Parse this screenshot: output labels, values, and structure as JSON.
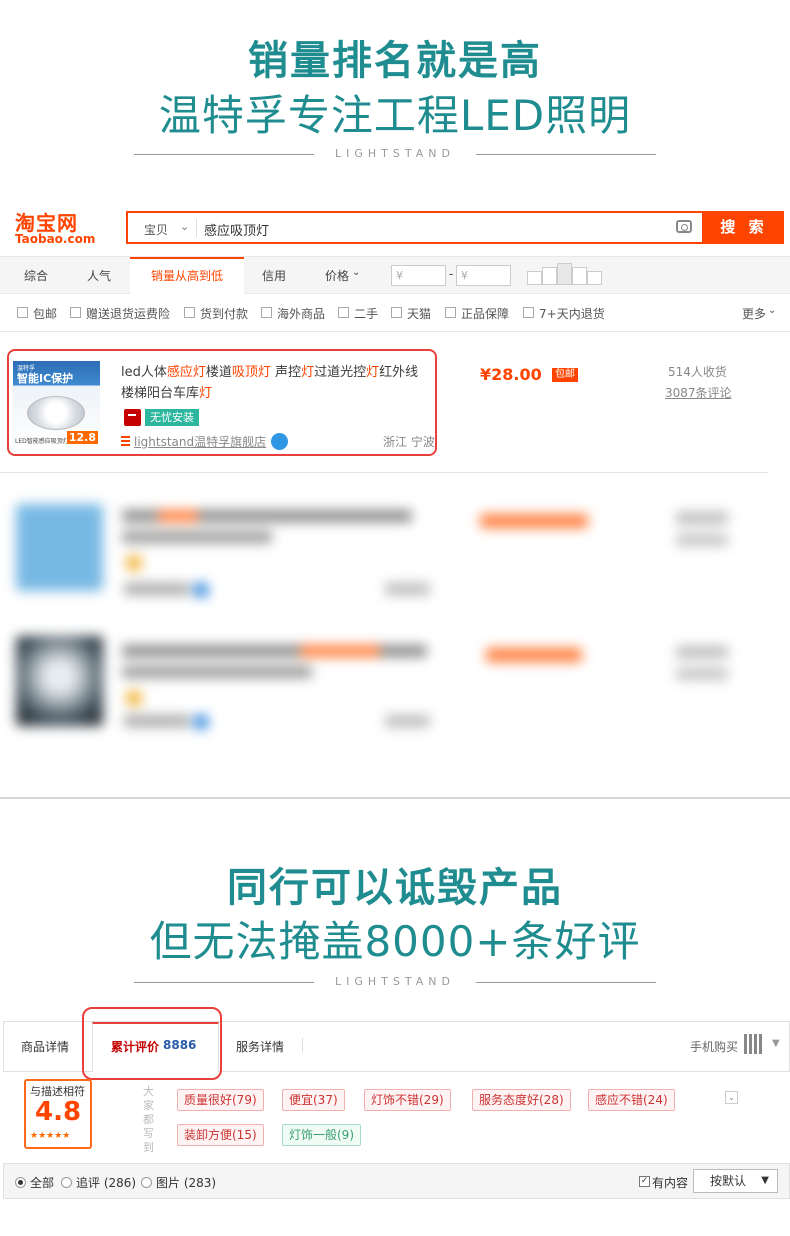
{
  "hero1": {
    "title": "销量排名就是高",
    "subtitle": "温特孚专注工程LED照明",
    "brand": "LIGHTSTAND"
  },
  "hero2": {
    "title": "同行可以诋毁产品",
    "subtitle": "但无法掩盖8000+条好评",
    "brand": "LIGHTSTAND"
  },
  "taobao": {
    "logo_cn": "淘宝网",
    "logo_en": "Taobao.com",
    "search_type": "宝贝",
    "search_value": "感应吸顶灯",
    "search_button": "搜 索"
  },
  "sort_bar": {
    "items": [
      "综合",
      "人气",
      "销量从高到低",
      "信用",
      "价格"
    ],
    "price_placeholder": "¥",
    "price_dash": "-"
  },
  "filters": {
    "items": [
      "包邮",
      "赠送退货运费险",
      "货到付款",
      "海外商品",
      "二手",
      "天猫",
      "正品保障",
      "7+天内退货"
    ],
    "more": "更多"
  },
  "product": {
    "image_brand": "温特孚",
    "image_title": "智能IC保护",
    "image_caption": "LED智能感应吸顶灯",
    "image_price": "12.8",
    "title_parts": [
      "led人体",
      "感应灯",
      "楼道",
      "吸顶灯",
      " 声控",
      "灯",
      "过道光控",
      "灯",
      "红外线楼梯阳台车库",
      "灯"
    ],
    "badge": "无忧安装",
    "shop": "lightstand温特孚旗舰店",
    "location": "浙江 宁波",
    "price": "¥28.00",
    "mail_badge": "包邮",
    "sales": "514人收货",
    "reviews": "3087条评论"
  },
  "review_panel": {
    "tabs": [
      "商品详情",
      "累计评价",
      "服务详情"
    ],
    "review_count": "8886",
    "mobile_buy": "手机购买",
    "score_label": "与描述相符",
    "score": "4.8",
    "stars": "★★★★★",
    "side_text": "大家都写到",
    "tags": [
      "质量很好(79)",
      "便宜(37)",
      "灯饰不错(29)",
      "服务态度好(28)",
      "感应不错(24)",
      "装卸方便(15)",
      "灯饰一般(9)"
    ],
    "filter_all": "全部",
    "filter_append": "追评 (286)",
    "filter_pics": "图片 (283)",
    "has_content": "有内容",
    "sort_default": "按默认"
  }
}
